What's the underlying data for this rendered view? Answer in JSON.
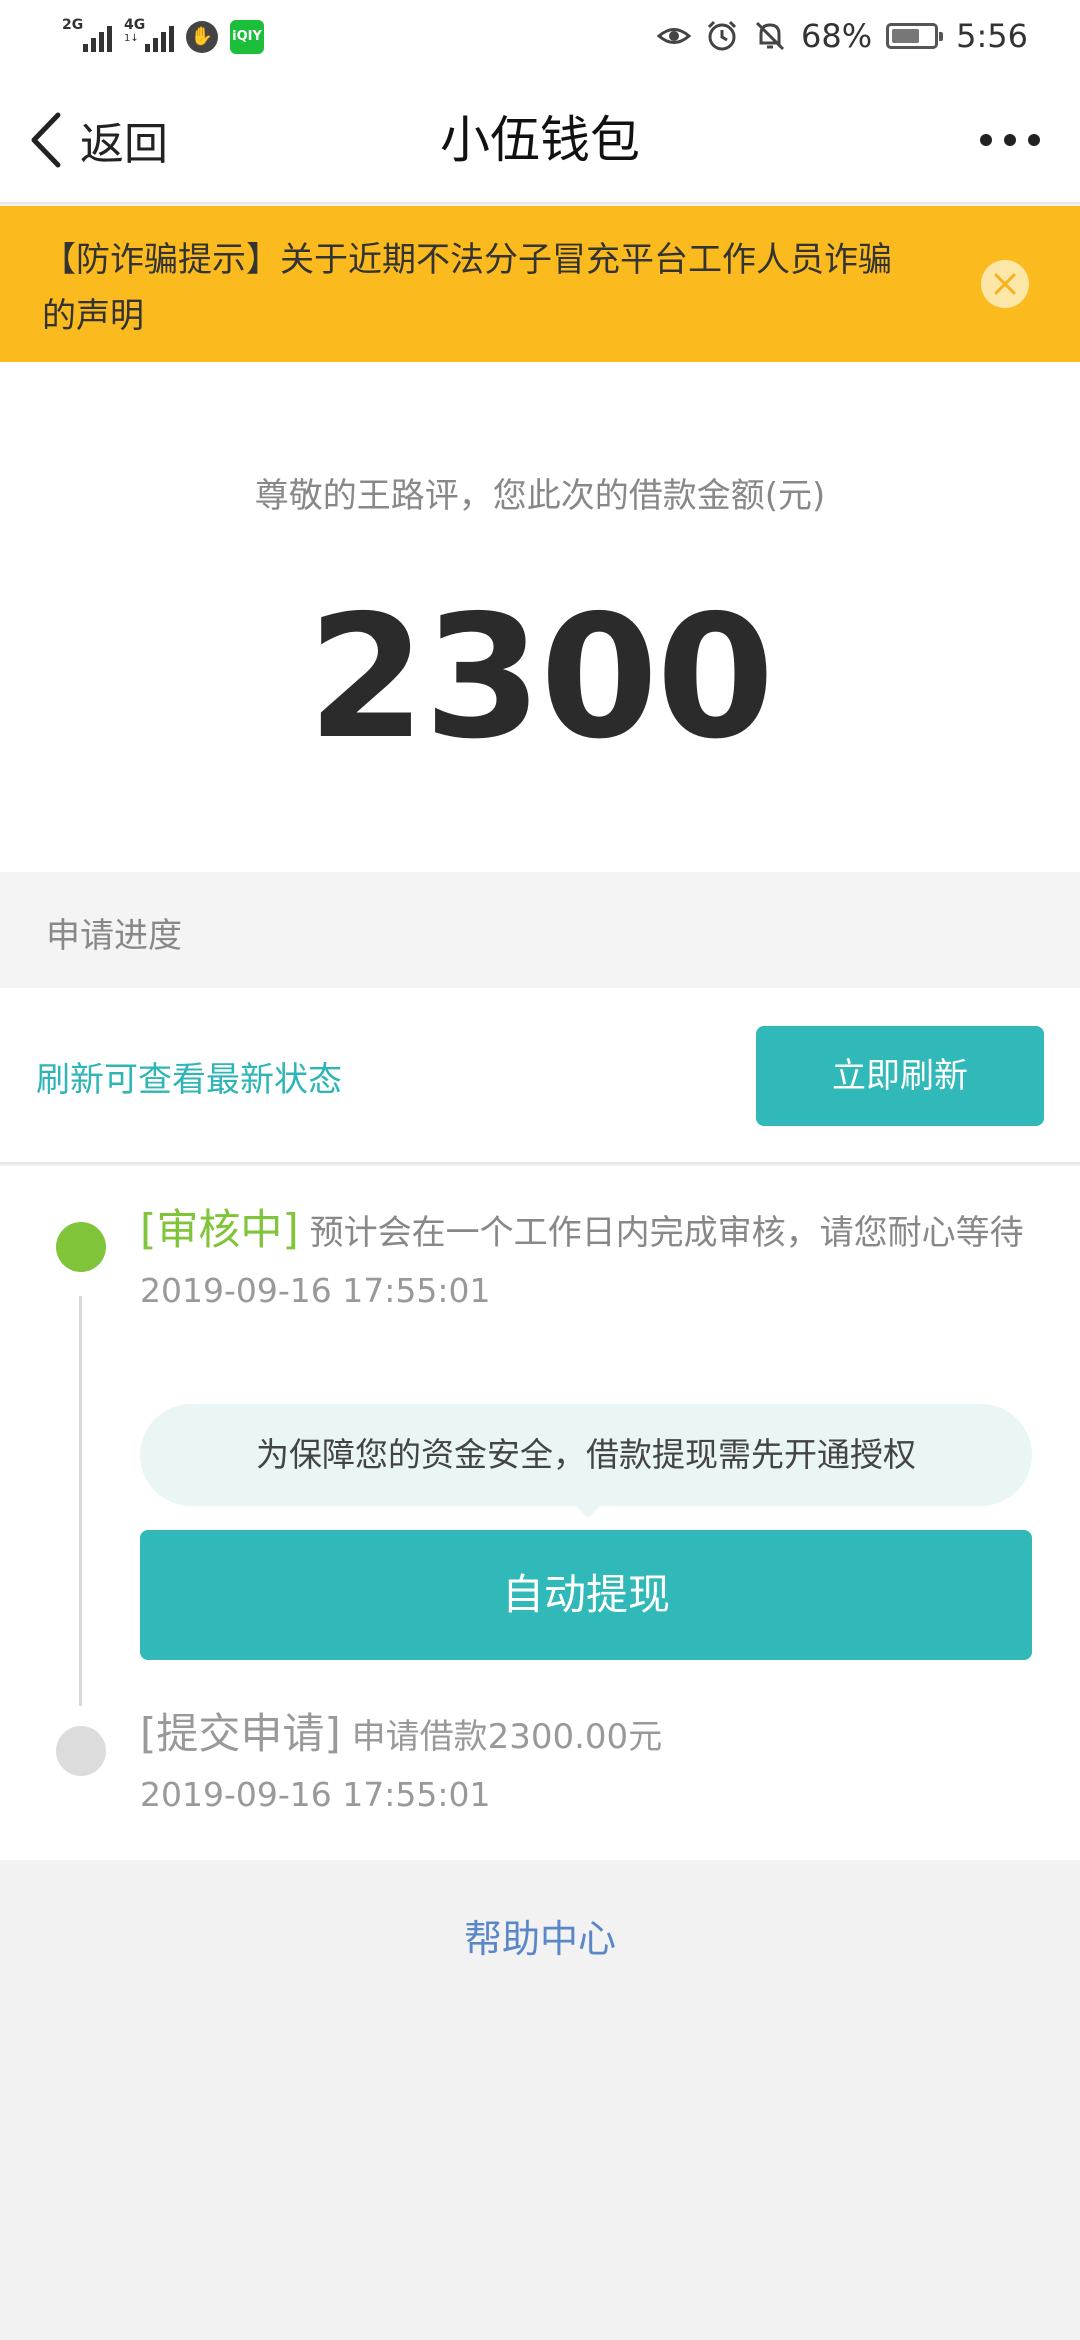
{
  "status_bar": {
    "network1": "2G",
    "network2": "4G",
    "network2_sub": "1↓",
    "app_badge": "iQIY",
    "battery_percent": "68%",
    "battery_level": 0.68,
    "time": "5:56",
    "icons": [
      "eye-icon",
      "alarm-icon",
      "mute-bell-icon",
      "battery-icon"
    ]
  },
  "nav": {
    "back_label": "返回",
    "title": "小伍钱包"
  },
  "notice": {
    "text": "【防诈骗提示】关于近期不法分子冒充平台工作人员诈骗的声明",
    "color": "#fbbb1e"
  },
  "loan": {
    "label": "尊敬的王路评，您此次的借款金额(元)",
    "amount": "2300"
  },
  "progress": {
    "header": "申请进度",
    "refresh_hint": "刷新可查看最新状态",
    "refresh_button": "立即刷新"
  },
  "timeline": {
    "steps": [
      {
        "tag": "[审核中]",
        "text": "预计会在一个工作日内完成审核，请您耐心等待",
        "time": "2019-09-16 17:55:01",
        "status": "active",
        "color": "#80c43a"
      },
      {
        "tag": "[提交申请]",
        "text": "申请借款2300.00元",
        "time": "2019-09-16 17:55:01",
        "status": "done",
        "color": "#dcdcdc"
      }
    ],
    "auth_notice": "为保障您的资金安全，借款提现需先开通授权",
    "withdraw_button": "自动提现"
  },
  "help": {
    "label": "帮助中心"
  },
  "colors": {
    "accent": "#30b9b8",
    "link": "#5b87c7"
  }
}
